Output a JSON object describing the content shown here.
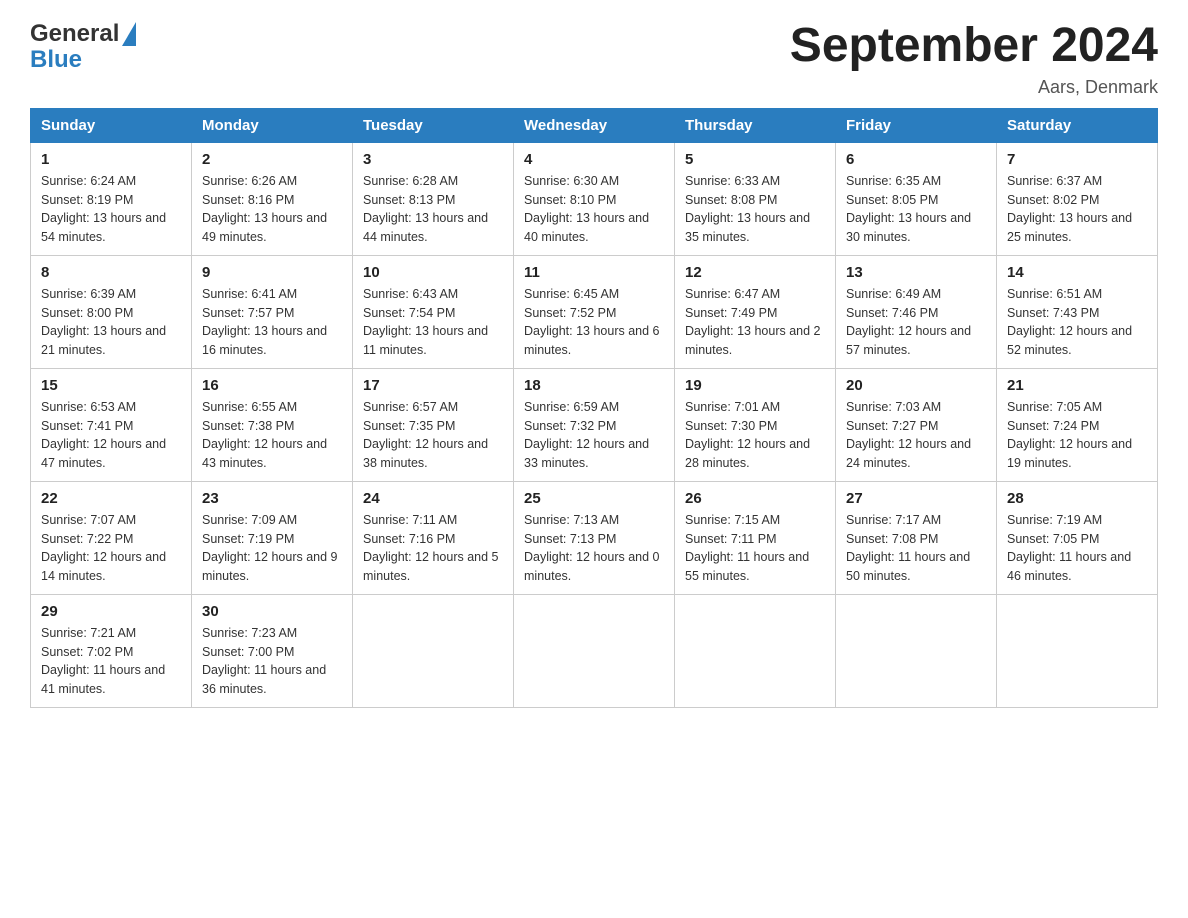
{
  "header": {
    "logo_general": "General",
    "logo_blue": "Blue",
    "month_title": "September 2024",
    "location": "Aars, Denmark"
  },
  "days_of_week": [
    "Sunday",
    "Monday",
    "Tuesday",
    "Wednesday",
    "Thursday",
    "Friday",
    "Saturday"
  ],
  "weeks": [
    [
      {
        "day": "1",
        "sunrise": "6:24 AM",
        "sunset": "8:19 PM",
        "daylight": "13 hours and 54 minutes."
      },
      {
        "day": "2",
        "sunrise": "6:26 AM",
        "sunset": "8:16 PM",
        "daylight": "13 hours and 49 minutes."
      },
      {
        "day": "3",
        "sunrise": "6:28 AM",
        "sunset": "8:13 PM",
        "daylight": "13 hours and 44 minutes."
      },
      {
        "day": "4",
        "sunrise": "6:30 AM",
        "sunset": "8:10 PM",
        "daylight": "13 hours and 40 minutes."
      },
      {
        "day": "5",
        "sunrise": "6:33 AM",
        "sunset": "8:08 PM",
        "daylight": "13 hours and 35 minutes."
      },
      {
        "day": "6",
        "sunrise": "6:35 AM",
        "sunset": "8:05 PM",
        "daylight": "13 hours and 30 minutes."
      },
      {
        "day": "7",
        "sunrise": "6:37 AM",
        "sunset": "8:02 PM",
        "daylight": "13 hours and 25 minutes."
      }
    ],
    [
      {
        "day": "8",
        "sunrise": "6:39 AM",
        "sunset": "8:00 PM",
        "daylight": "13 hours and 21 minutes."
      },
      {
        "day": "9",
        "sunrise": "6:41 AM",
        "sunset": "7:57 PM",
        "daylight": "13 hours and 16 minutes."
      },
      {
        "day": "10",
        "sunrise": "6:43 AM",
        "sunset": "7:54 PM",
        "daylight": "13 hours and 11 minutes."
      },
      {
        "day": "11",
        "sunrise": "6:45 AM",
        "sunset": "7:52 PM",
        "daylight": "13 hours and 6 minutes."
      },
      {
        "day": "12",
        "sunrise": "6:47 AM",
        "sunset": "7:49 PM",
        "daylight": "13 hours and 2 minutes."
      },
      {
        "day": "13",
        "sunrise": "6:49 AM",
        "sunset": "7:46 PM",
        "daylight": "12 hours and 57 minutes."
      },
      {
        "day": "14",
        "sunrise": "6:51 AM",
        "sunset": "7:43 PM",
        "daylight": "12 hours and 52 minutes."
      }
    ],
    [
      {
        "day": "15",
        "sunrise": "6:53 AM",
        "sunset": "7:41 PM",
        "daylight": "12 hours and 47 minutes."
      },
      {
        "day": "16",
        "sunrise": "6:55 AM",
        "sunset": "7:38 PM",
        "daylight": "12 hours and 43 minutes."
      },
      {
        "day": "17",
        "sunrise": "6:57 AM",
        "sunset": "7:35 PM",
        "daylight": "12 hours and 38 minutes."
      },
      {
        "day": "18",
        "sunrise": "6:59 AM",
        "sunset": "7:32 PM",
        "daylight": "12 hours and 33 minutes."
      },
      {
        "day": "19",
        "sunrise": "7:01 AM",
        "sunset": "7:30 PM",
        "daylight": "12 hours and 28 minutes."
      },
      {
        "day": "20",
        "sunrise": "7:03 AM",
        "sunset": "7:27 PM",
        "daylight": "12 hours and 24 minutes."
      },
      {
        "day": "21",
        "sunrise": "7:05 AM",
        "sunset": "7:24 PM",
        "daylight": "12 hours and 19 minutes."
      }
    ],
    [
      {
        "day": "22",
        "sunrise": "7:07 AM",
        "sunset": "7:22 PM",
        "daylight": "12 hours and 14 minutes."
      },
      {
        "day": "23",
        "sunrise": "7:09 AM",
        "sunset": "7:19 PM",
        "daylight": "12 hours and 9 minutes."
      },
      {
        "day": "24",
        "sunrise": "7:11 AM",
        "sunset": "7:16 PM",
        "daylight": "12 hours and 5 minutes."
      },
      {
        "day": "25",
        "sunrise": "7:13 AM",
        "sunset": "7:13 PM",
        "daylight": "12 hours and 0 minutes."
      },
      {
        "day": "26",
        "sunrise": "7:15 AM",
        "sunset": "7:11 PM",
        "daylight": "11 hours and 55 minutes."
      },
      {
        "day": "27",
        "sunrise": "7:17 AM",
        "sunset": "7:08 PM",
        "daylight": "11 hours and 50 minutes."
      },
      {
        "day": "28",
        "sunrise": "7:19 AM",
        "sunset": "7:05 PM",
        "daylight": "11 hours and 46 minutes."
      }
    ],
    [
      {
        "day": "29",
        "sunrise": "7:21 AM",
        "sunset": "7:02 PM",
        "daylight": "11 hours and 41 minutes."
      },
      {
        "day": "30",
        "sunrise": "7:23 AM",
        "sunset": "7:00 PM",
        "daylight": "11 hours and 36 minutes."
      },
      {
        "day": "",
        "sunrise": "",
        "sunset": "",
        "daylight": ""
      },
      {
        "day": "",
        "sunrise": "",
        "sunset": "",
        "daylight": ""
      },
      {
        "day": "",
        "sunrise": "",
        "sunset": "",
        "daylight": ""
      },
      {
        "day": "",
        "sunrise": "",
        "sunset": "",
        "daylight": ""
      },
      {
        "day": "",
        "sunrise": "",
        "sunset": "",
        "daylight": ""
      }
    ]
  ],
  "labels": {
    "sunrise": "Sunrise:",
    "sunset": "Sunset:",
    "daylight": "Daylight:"
  }
}
